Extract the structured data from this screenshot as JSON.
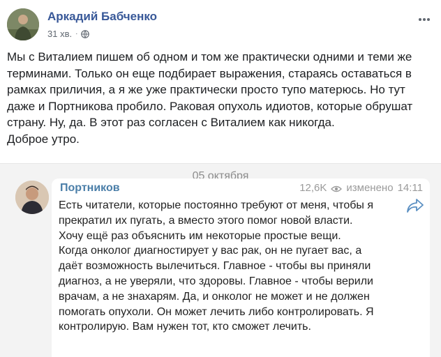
{
  "post": {
    "author": "Аркадий Бабченко",
    "time": "31 хв.",
    "separator": "·",
    "privacy_icon": "globe-icon",
    "more_icon": "more-options-icon",
    "paragraphs": [
      "Мы с Виталием пишем об одном и том же практически одними и теми же терминами. Только он еще подбирает выражения, стараясь оставаться в рамках приличия, а я же уже практически просто тупо матерюсь. Но тут даже и Портникова пробило. Раковая опухоль идиотов, которые обрушат страну. Ну, да. В этот раз согласен с Виталием как никогда.",
      "Доброе утро."
    ]
  },
  "embed": {
    "date": "05 октября",
    "channel": "Портников",
    "views": "12,6K",
    "views_icon": "eye-icon",
    "edited": "изменено",
    "time": "14:11",
    "share_icon": "share-arrow-icon",
    "paragraphs": [
      "Есть читатели, которые постоянно требуют от меня, чтобы я прекратил их пугать, а вместо этого помог новой власти. Хочу ещё раз объяснить им некоторые простые вещи.",
      "Когда онколог диагностирует у вас рак, он не пугает вас, а даёт возможность вылечиться. Главное - чтобы вы приняли диагноз, а не уверяли, что здоровы. Главное - чтобы верили врачам, а не знахарям. Да, и онколог не может и не должен помогать опухоли. Он может лечить либо контролировать. Я контролирую. Вам нужен тот, кто сможет лечить."
    ]
  },
  "colors": {
    "author_link": "#385898",
    "channel": "#4a7ea8",
    "embed_bg": "#f3f3f3",
    "meta_gray": "#606770"
  }
}
